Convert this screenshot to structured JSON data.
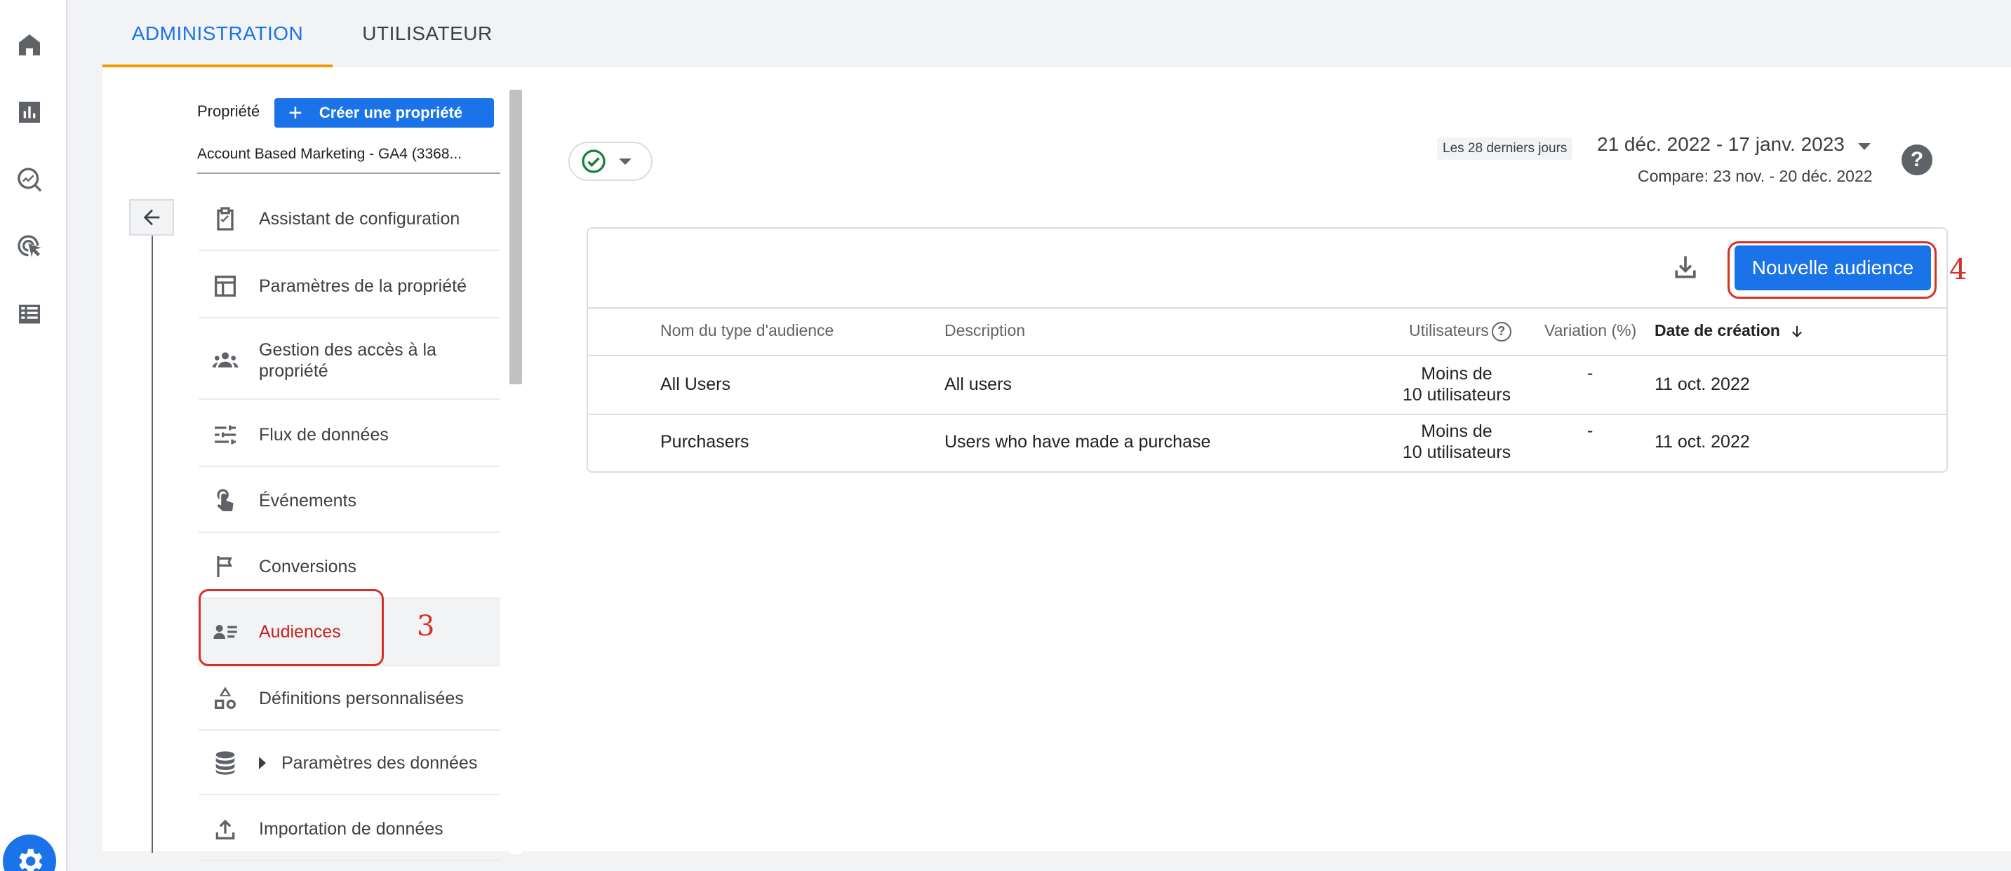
{
  "rail": {
    "icons": [
      "home-icon",
      "reports-icon",
      "explore-icon",
      "advertising-icon",
      "configure-icon"
    ],
    "settings_icon": "gear-icon"
  },
  "tabs": [
    {
      "label": "ADMINISTRATION",
      "active": true
    },
    {
      "label": "UTILISATEUR",
      "active": false
    }
  ],
  "property": {
    "label": "Propriété",
    "create_button": "Créer une propriété",
    "account_name": "Account Based Marketing  - GA4 (3368..."
  },
  "menu": [
    {
      "label": "Assistant de configuration",
      "icon": "clipboard-check-icon"
    },
    {
      "label": "Paramètres de la propriété",
      "icon": "layout-icon"
    },
    {
      "label": "Gestion des accès à la propriété",
      "icon": "people-icon"
    },
    {
      "label": "Flux de données",
      "icon": "data-streams-icon"
    },
    {
      "label": "Événements",
      "icon": "touch-icon"
    },
    {
      "label": "Conversions",
      "icon": "flag-icon"
    },
    {
      "label": "Audiences",
      "icon": "audience-list-icon",
      "selected": true
    },
    {
      "label": "Définitions personnalisées",
      "icon": "shapes-icon"
    },
    {
      "label": "Paramètres des données",
      "icon": "database-icon",
      "expandable": true
    },
    {
      "label": "Importation de données",
      "icon": "upload-icon"
    }
  ],
  "annotations": {
    "step3": "3",
    "step4": "4"
  },
  "date_range": {
    "preset": "Les 28 derniers jours",
    "dates": "21 déc. 2022 - 17 janv. 2023",
    "compare": "Compare: 23 nov. - 20 déc. 2022"
  },
  "help_label": "?",
  "table": {
    "new_button": "Nouvelle audience",
    "columns": [
      "Nom du type d'audience",
      "Description",
      "Utilisateurs",
      "Variation (%)",
      "Date de création"
    ],
    "rows": [
      {
        "name": "All Users",
        "description": "All users",
        "users_line1": "Moins de",
        "users_line2": "10 utilisateurs",
        "variation": "-",
        "created": "11 oct. 2022"
      },
      {
        "name": "Purchasers",
        "description": "Users who have made a purchase",
        "users_line1": "Moins de",
        "users_line2": "10 utilisateurs",
        "variation": "-",
        "created": "11 oct. 2022"
      }
    ]
  },
  "colors": {
    "accent": "#1a73e8",
    "highlight": "#d93025",
    "tab_indicator": "#f29900"
  }
}
